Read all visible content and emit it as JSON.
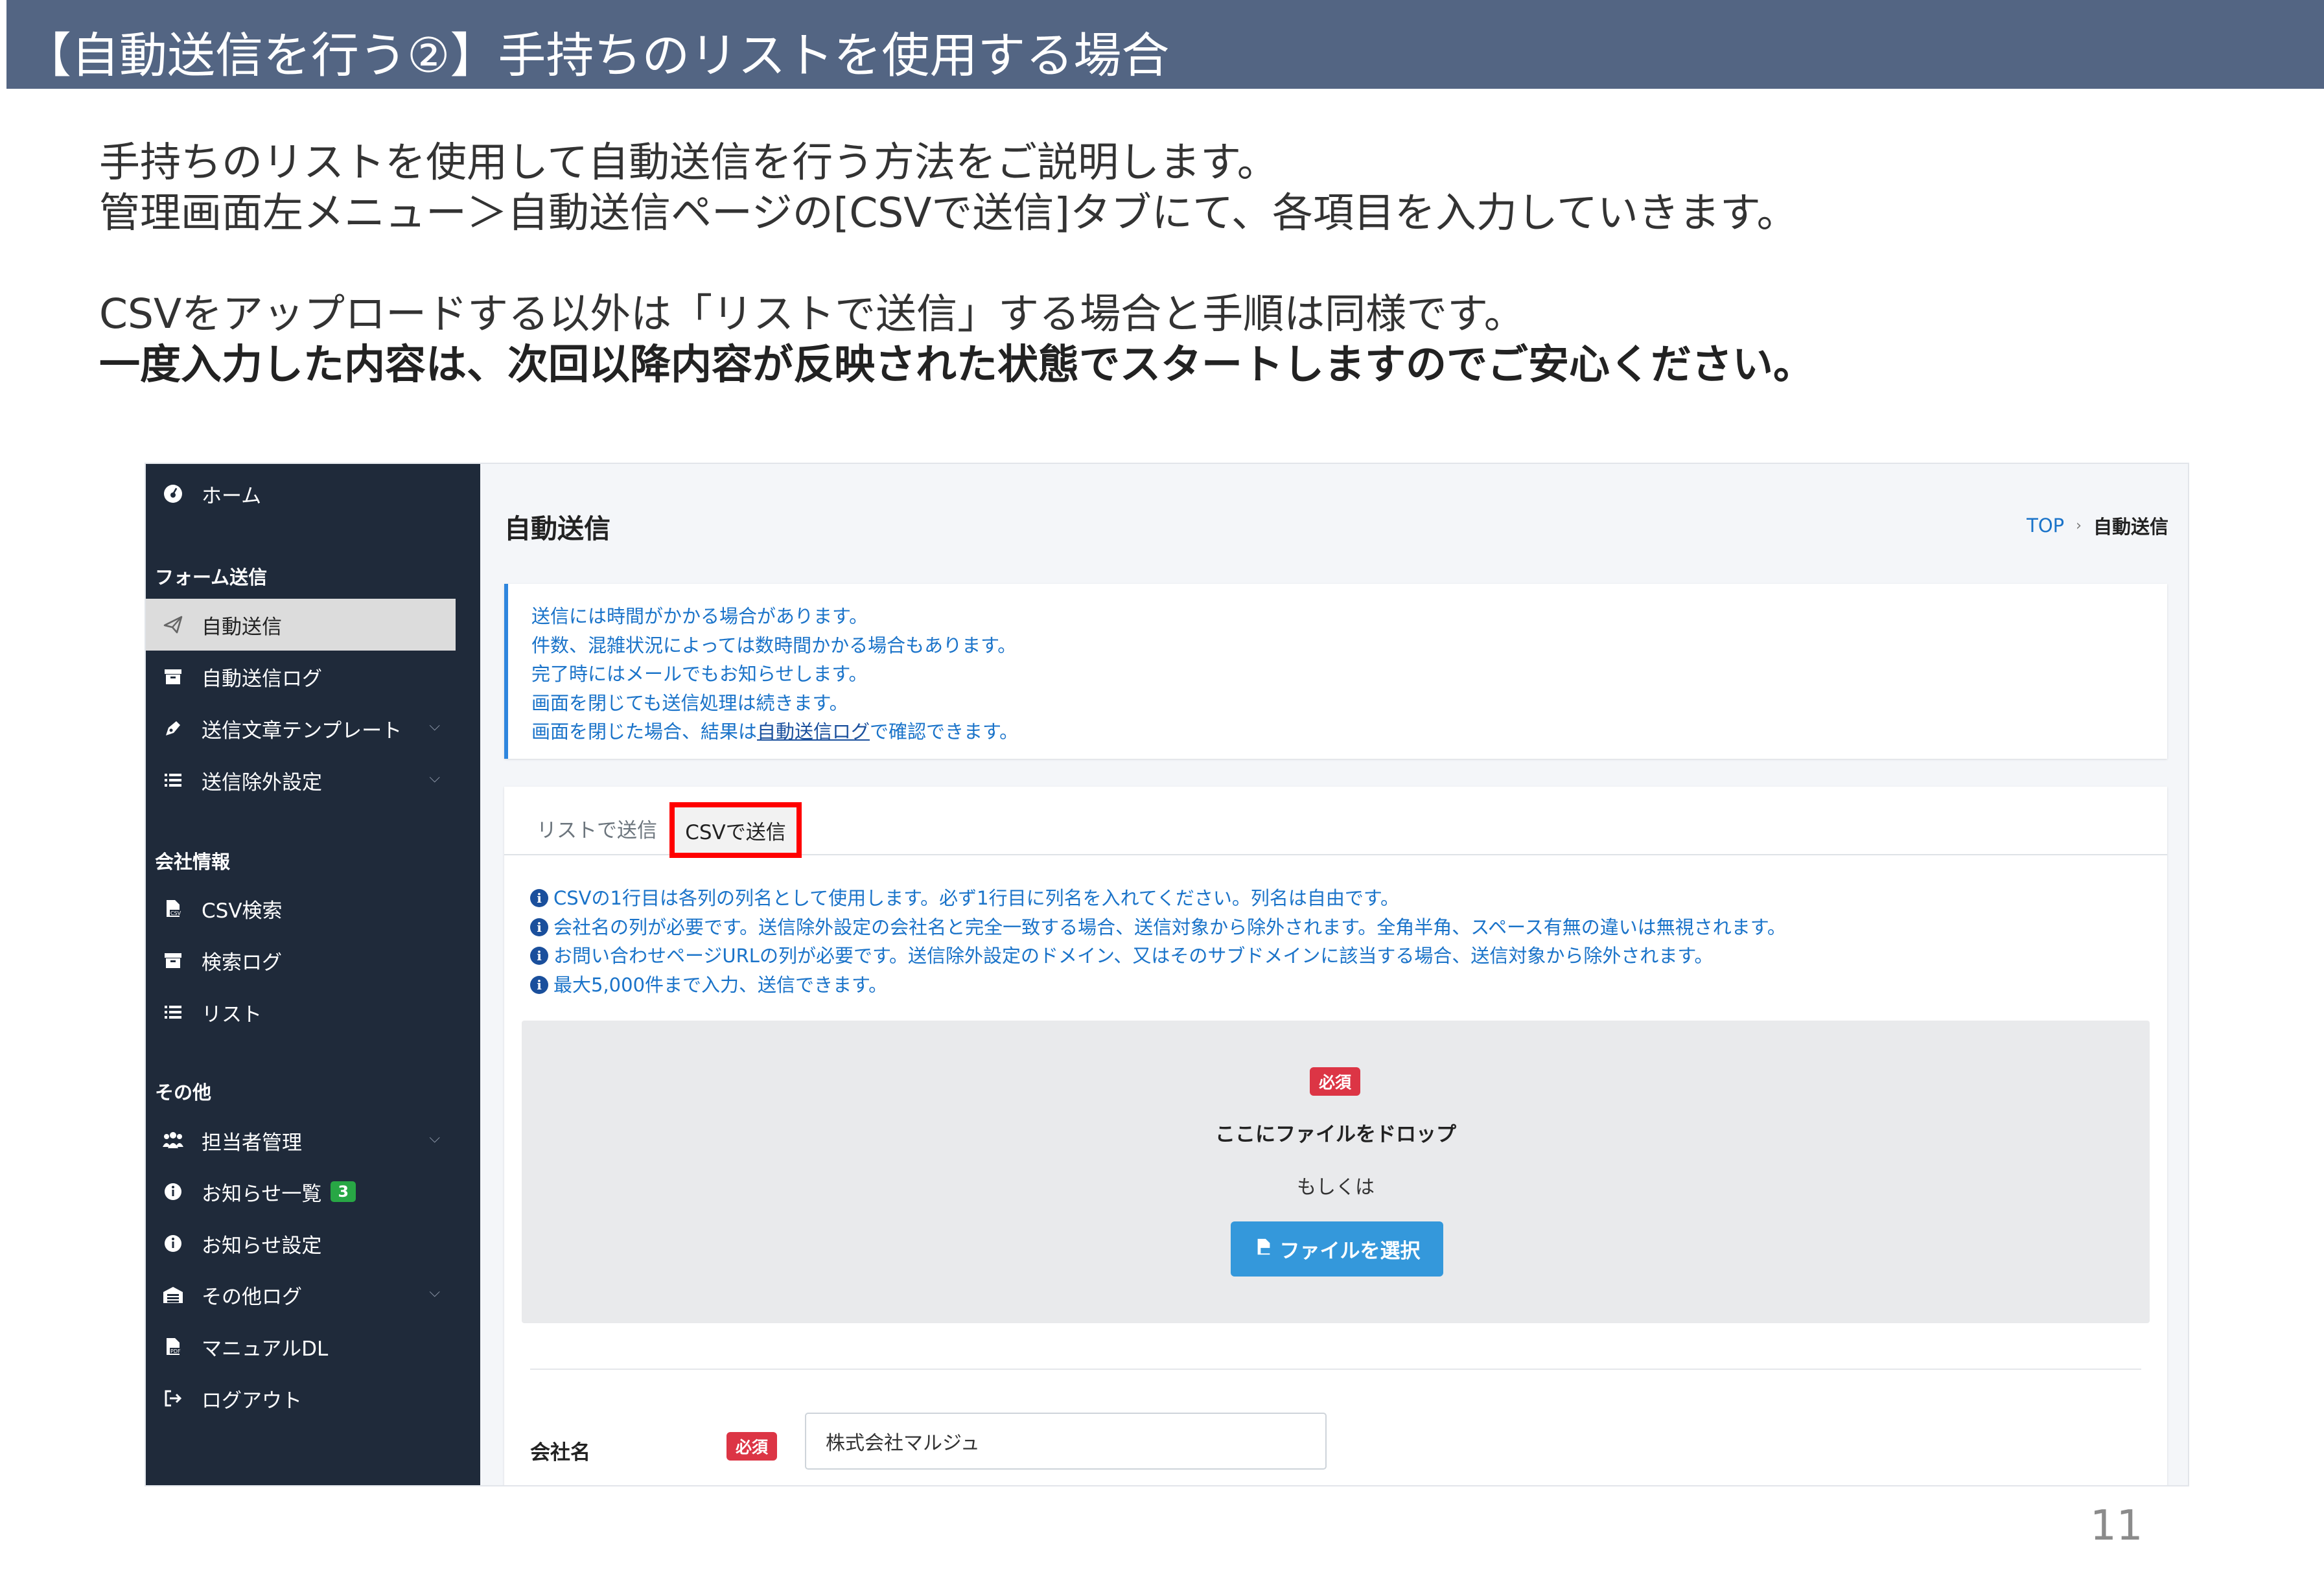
{
  "slide": {
    "title": "【自動送信を行う②】手持ちのリストを使用する場合",
    "intro": {
      "line1": "手持ちのリストを使用して自動送信を行う方法をご説明します。",
      "line2": "管理画面左メニュー＞自動送信ページの[CSVで送信]タブにて、各項目を入力していきます。",
      "line3": "CSVをアップロードする以外は「リストで送信」する場合と手順は同様です。",
      "line4": "一度入力した内容は、次回以降内容が反映された状態でスタートしますのでご安心ください。"
    },
    "page_number": "11"
  },
  "sidebar": {
    "home": "ホーム",
    "sections": {
      "form": "フォーム送信",
      "company": "会社情報",
      "other": "その他"
    },
    "items": {
      "auto_send": "自動送信",
      "auto_send_log": "自動送信ログ",
      "template": "送信文章テンプレート",
      "exclusion": "送信除外設定",
      "csv_search": "CSV検索",
      "search_log": "検索ログ",
      "list": "リスト",
      "staff": "担当者管理",
      "notices": "お知らせ一覧",
      "notice_settings": "お知らせ設定",
      "other_log": "その他ログ",
      "manual": "マニュアルDL",
      "logout": "ログアウト"
    },
    "notices_badge": "3"
  },
  "main": {
    "heading": "自動送信",
    "breadcrumb": {
      "top": "TOP",
      "current": "自動送信"
    },
    "callout": {
      "line1": "送信には時間がかかる場合があります。",
      "line2": "件数、混雑状況によっては数時間かかる場合もあります。",
      "line3": "完了時にはメールでもお知らせします。",
      "line4": "画面を閉じても送信処理は続きます。",
      "line5_pre": "画面を閉じた場合、結果は",
      "line5_link": "自動送信ログ",
      "line5_post": "で確認できます。"
    },
    "tabs": {
      "list": "リストで送信",
      "csv": "CSVで送信"
    },
    "info": [
      "CSVの1行目は各列の列名として使用します。必ず1行目に列名を入れてください。列名は自由です。",
      "会社名の列が必要です。送信除外設定の会社名と完全一致する場合、送信対象から除外されます。全角半角、スペース有無の違いは無視されます。",
      "お問い合わせページURLの列が必要です。送信除外設定のドメイン、又はそのサブドメインに該当する場合、送信対象から除外されます。",
      "最大5,000件まで入力、送信できます。"
    ],
    "dropzone": {
      "required": "必須",
      "drop": "ここにファイルをドロップ",
      "or": "もしくは",
      "button": "ファイルを選択"
    },
    "company": {
      "label": "会社名",
      "required": "必須",
      "value": "株式会社マルジュ"
    }
  }
}
